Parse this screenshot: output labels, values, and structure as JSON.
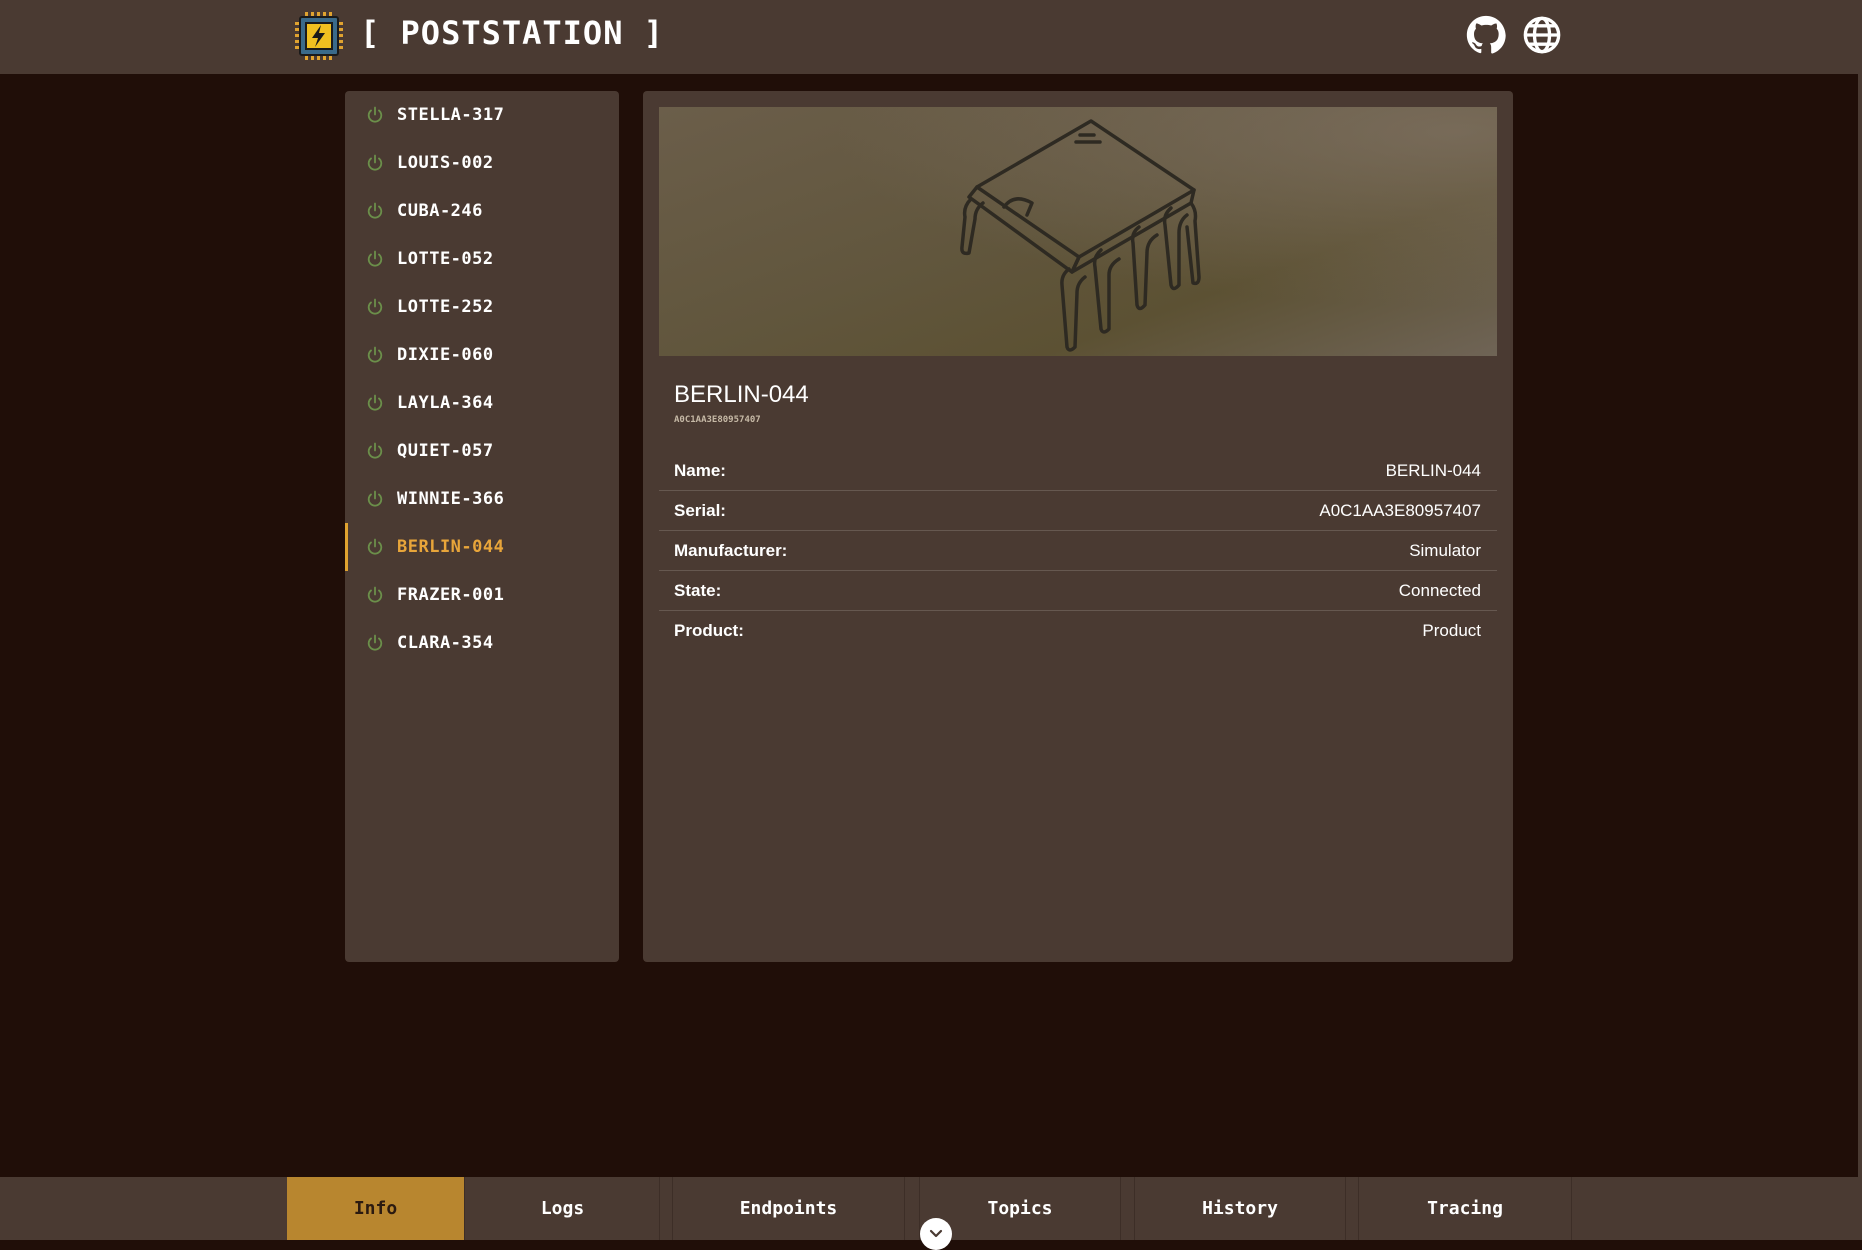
{
  "app": {
    "title": "[ POSTSTATION ]",
    "logo_icon": "chip-bolt-icon",
    "header_icons": [
      "github-icon",
      "globe-icon"
    ]
  },
  "sidebar": {
    "devices": [
      {
        "label": "STELLA-317",
        "active": false
      },
      {
        "label": "LOUIS-002",
        "active": false
      },
      {
        "label": "CUBA-246",
        "active": false
      },
      {
        "label": "LOTTE-052",
        "active": false
      },
      {
        "label": "LOTTE-252",
        "active": false
      },
      {
        "label": "DIXIE-060",
        "active": false
      },
      {
        "label": "LAYLA-364",
        "active": false
      },
      {
        "label": "QUIET-057",
        "active": false
      },
      {
        "label": "WINNIE-366",
        "active": false
      },
      {
        "label": "BERLIN-044",
        "active": true
      },
      {
        "label": "FRAZER-001",
        "active": false
      },
      {
        "label": "CLARA-354",
        "active": false
      }
    ],
    "item_icon": "power-icon"
  },
  "detail": {
    "hero_icon": "ic-chip-icon",
    "title": "BERLIN-044",
    "serial_small": "A0C1AA3E80957407",
    "rows": [
      {
        "key": "Name:",
        "value": "BERLIN-044"
      },
      {
        "key": "Serial:",
        "value": "A0C1AA3E80957407"
      },
      {
        "key": "Manufacturer:",
        "value": "Simulator"
      },
      {
        "key": "State:",
        "value": "Connected"
      },
      {
        "key": "Product:",
        "value": "Product"
      }
    ]
  },
  "tabs": [
    {
      "label": "Info",
      "active": true
    },
    {
      "label": "Logs",
      "active": false
    },
    {
      "label": "Endpoints",
      "active": false
    },
    {
      "label": "Topics",
      "active": false
    },
    {
      "label": "History",
      "active": false
    },
    {
      "label": "Tracing",
      "active": false
    }
  ],
  "colors": {
    "background": "#200e08",
    "panel": "#4a3a32",
    "accent": "#e8a53a",
    "active_tab": "#b8862f",
    "power_icon": "#6b8f4a"
  }
}
